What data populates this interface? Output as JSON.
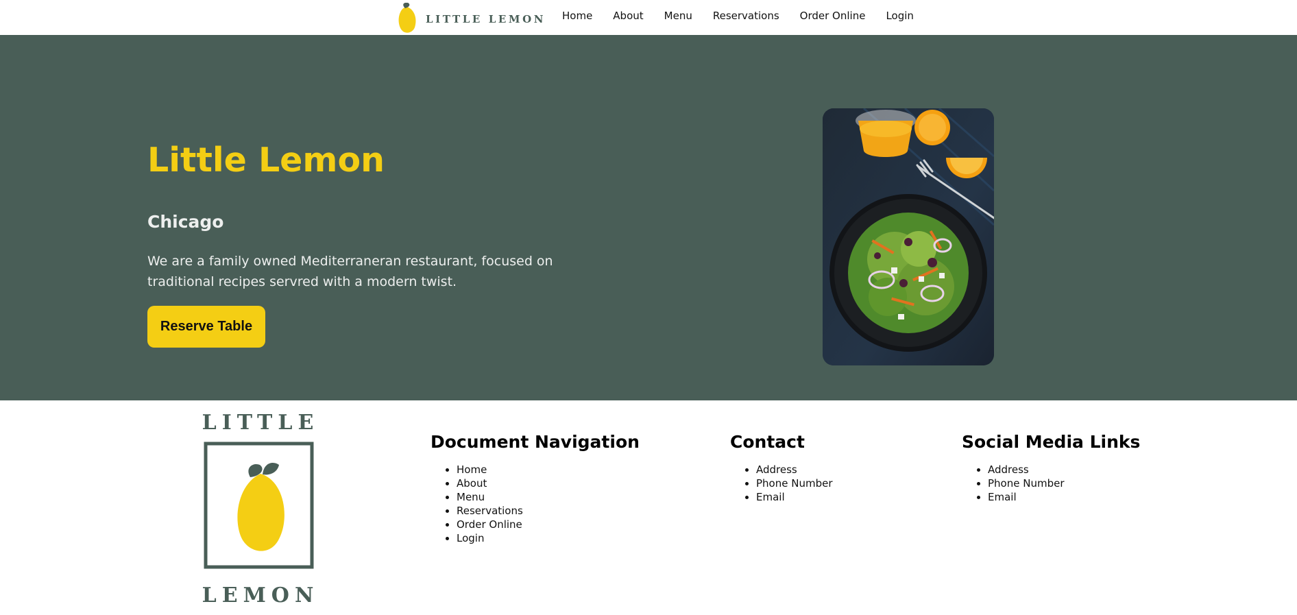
{
  "header": {
    "logo_text": "LITTLE LEMON",
    "nav": [
      "Home",
      "About",
      "Menu",
      "Reservations",
      "Order Online",
      "Login"
    ]
  },
  "hero": {
    "title": "Little Lemon",
    "subtitle": "Chicago",
    "description": "We are a family owned Mediterraneran restaurant, focused on traditional recipes servred with a modern twist.",
    "button_label": "Reserve Table"
  },
  "footer": {
    "logo_top": "LITTLE",
    "logo_bottom": "LEMON",
    "nav_heading": "Document Navigation",
    "nav_items": [
      "Home",
      "About",
      "Menu",
      "Reservations",
      "Order Online",
      "Login"
    ],
    "contact_heading": "Contact",
    "contact_items": [
      "Address",
      "Phone Number",
      "Email"
    ],
    "social_heading": "Social Media Links",
    "social_items": [
      "Address",
      "Phone Number",
      "Email"
    ]
  },
  "colors": {
    "primary_green": "#495E57",
    "primary_yellow": "#F4CE14",
    "light_text": "#EDEFEE"
  }
}
